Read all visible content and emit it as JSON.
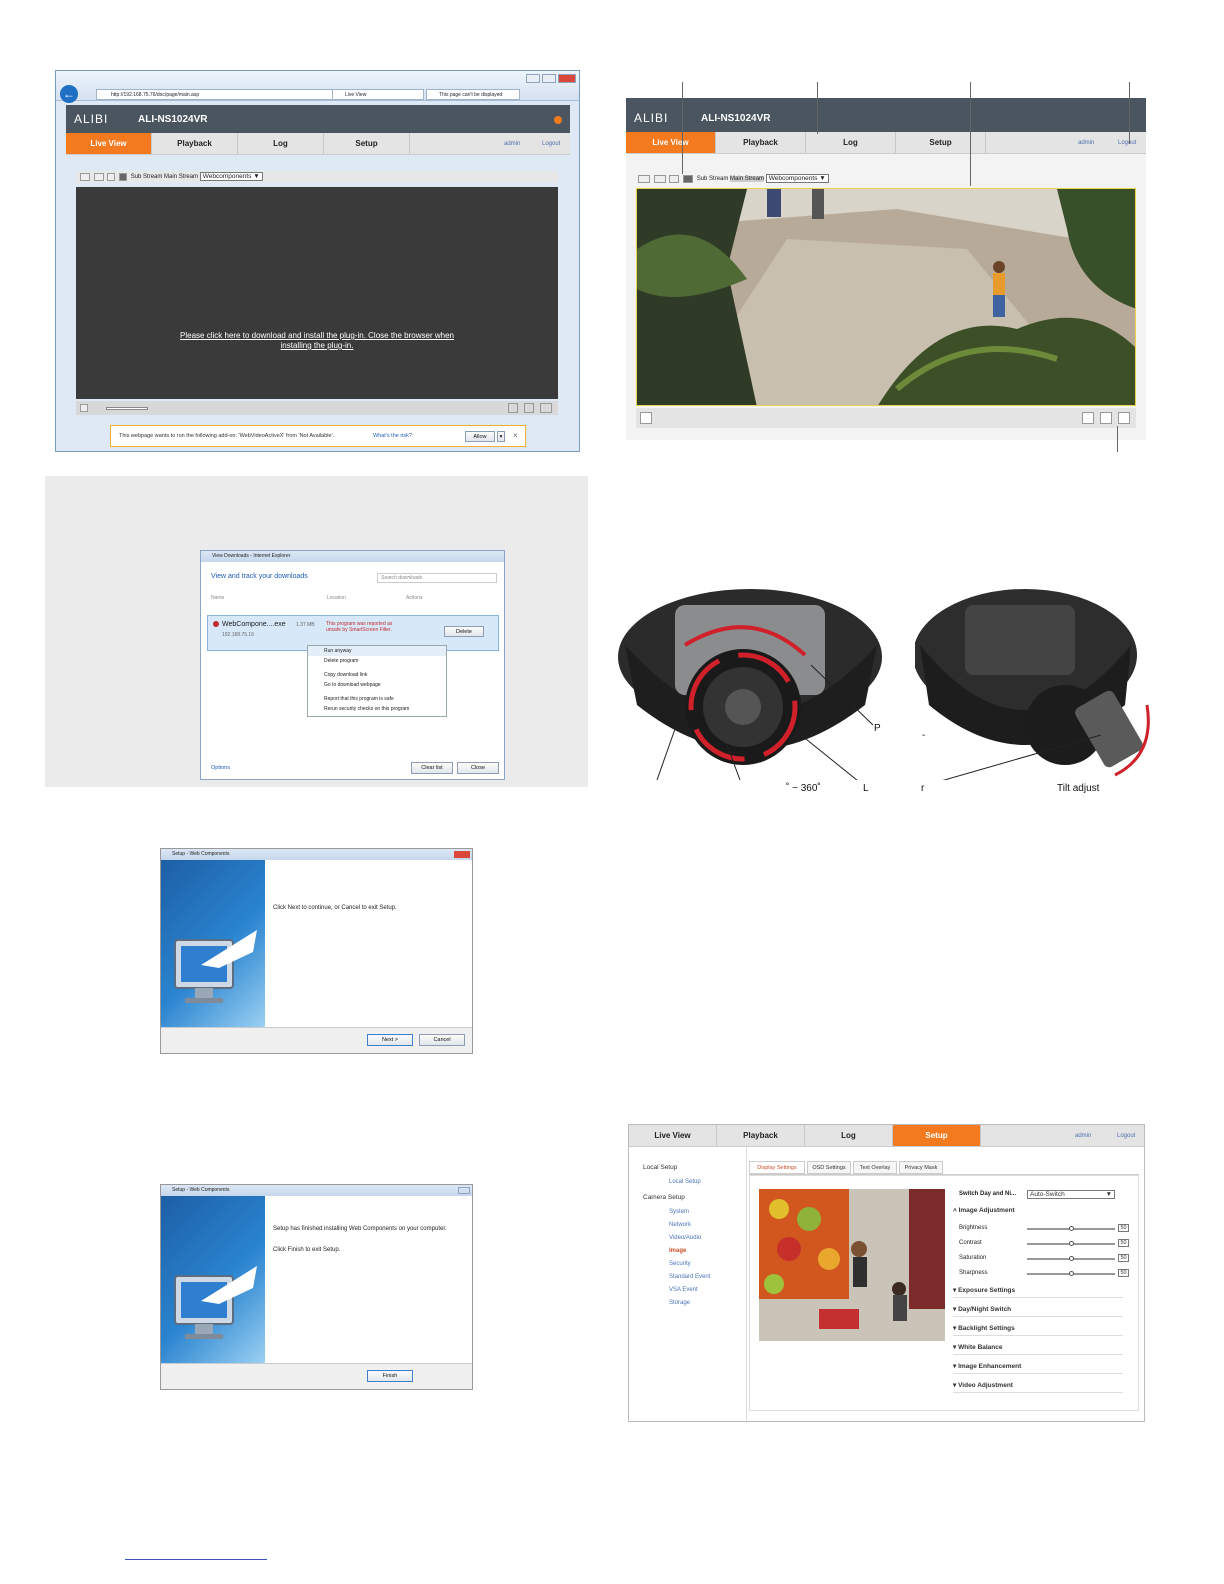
{
  "browser": {
    "url": "http://192.168.75.76/doc/page/main.asp",
    "tab1": "Live View",
    "tab2": "This page can't be displayed"
  },
  "app": {
    "logo": "ALIBI",
    "model": "ALI-NS1024VR",
    "nav": [
      "Live View",
      "Playback",
      "Log",
      "Setup"
    ],
    "user": "admin",
    "logout": "Logout",
    "stream_sub": "Sub Stream",
    "stream_main": "Main Stream",
    "plugin_select": "Webcomponents",
    "plugin_message": "Please click here to download and install the plug-in. Close the browser when installing the plug-in."
  },
  "addon_bar": {
    "message": "This webpage wants to run the following add-on: 'WebVideoActiveX' from 'Not Available'.",
    "link": "What's the risk?",
    "allow": "Allow"
  },
  "downloads": {
    "window_title": "View Downloads - Internet Explorer",
    "heading": "View and track your downloads",
    "search_placeholder": "Search downloads",
    "col_name": "Name",
    "col_location": "Location",
    "col_actions": "Actions",
    "file": "WebCompone....exe",
    "size": "1.37 MB",
    "host": "192.168.75.16",
    "warning": "This program was reported as unsafe by SmartScreen Filter.",
    "delete": "Delete",
    "menu": [
      "Run anyway",
      "Delete program",
      "Copy download link",
      "Go to download webpage",
      "Report that this program is safe",
      "Rerun security checks on this program"
    ],
    "options": "Options",
    "clear": "Clear list",
    "close": "Close"
  },
  "setup1": {
    "title": "Setup - Web Components",
    "text": "Click Next to continue, or Cancel to exit Setup.",
    "next": "Next >",
    "cancel": "Cancel"
  },
  "setup2": {
    "title": "Setup - Web Components",
    "text1": "Setup has finished installing Web Components on your computer.",
    "text2": "Click Finish to exit Setup.",
    "finish": "Finish"
  },
  "captions": {
    "p": "P",
    "dash": "-",
    "range": "˚ ~ 360˚",
    "l": "L",
    "r": "r",
    "tilt": "Tilt adjust"
  },
  "setup_page": {
    "nav": [
      "Live View",
      "Playback",
      "Log",
      "Setup"
    ],
    "user": "admin",
    "logout": "Logout",
    "local_setup": "Local Setup",
    "local_setup_item": "Local Setup",
    "camera_setup": "Camera Setup",
    "camera_items": [
      "System",
      "Network",
      "Video/Audio",
      "Image",
      "Security",
      "Standard Event",
      "VSA Event",
      "Storage"
    ],
    "tabs": [
      "Display Settings",
      "OSD Settings",
      "Text Overlay",
      "Privacy Mask"
    ],
    "switch_label": "Switch Day and Ni...",
    "switch_value": "Auto-Switch",
    "image_adjustment": "Image Adjustment",
    "sliders": [
      {
        "label": "Brightness",
        "value": "50"
      },
      {
        "label": "Contrast",
        "value": "50"
      },
      {
        "label": "Saturation",
        "value": "50"
      },
      {
        "label": "Sharpness",
        "value": "50"
      }
    ],
    "sections": [
      "Exposure Settings",
      "Day/Night Switch",
      "Backlight Settings",
      "White Balance",
      "Image Enhancement",
      "Video Adjustment"
    ]
  }
}
